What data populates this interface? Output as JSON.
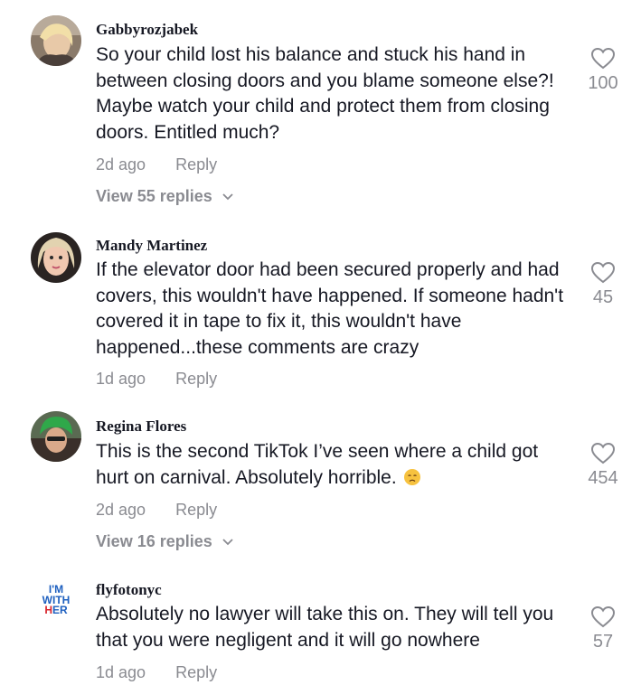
{
  "comments": [
    {
      "username": "Gabbyrozjabek",
      "text": "So your child lost his balance and stuck his hand in between closing doors and you blame someone else?! Maybe watch your child and protect them from closing doors. Entitled much?",
      "time": "2d ago",
      "reply": "Reply",
      "likes": "100",
      "replies": "View 55 replies",
      "avatar_icon": "user-avatar"
    },
    {
      "username": "Mandy Martinez",
      "text": "If the elevator door had been secured properly and had covers, this wouldn't have happened. If someone hadn't covered it in tape to fix it, this wouldn't have happened...these comments are crazy",
      "time": "1d ago",
      "reply": "Reply",
      "likes": "45",
      "avatar_icon": "user-avatar"
    },
    {
      "username": "Regina Flores",
      "text": "This is the second TikTok I’ve seen where a child got hurt on carnival. Absolutely horrible.",
      "emoji": "disappointed-face-emoji",
      "time": "2d ago",
      "reply": "Reply",
      "likes": "454",
      "replies": "View 16 replies",
      "avatar_icon": "user-avatar"
    },
    {
      "username": "flyfotonyc",
      "text": "Absolutely no lawyer will take this on. They will tell you that you were negligent and it will go nowhere",
      "time": "1d ago",
      "reply": "Reply",
      "likes": "57",
      "avatar_icon": "user-avatar",
      "avatar_text": [
        "I'M",
        "WITH",
        "HER"
      ]
    }
  ],
  "colors": {
    "text": "#161823",
    "secondary": "#8a8b91",
    "avatar_blue": "#1d5fbf",
    "avatar_red": "#d8262e"
  }
}
